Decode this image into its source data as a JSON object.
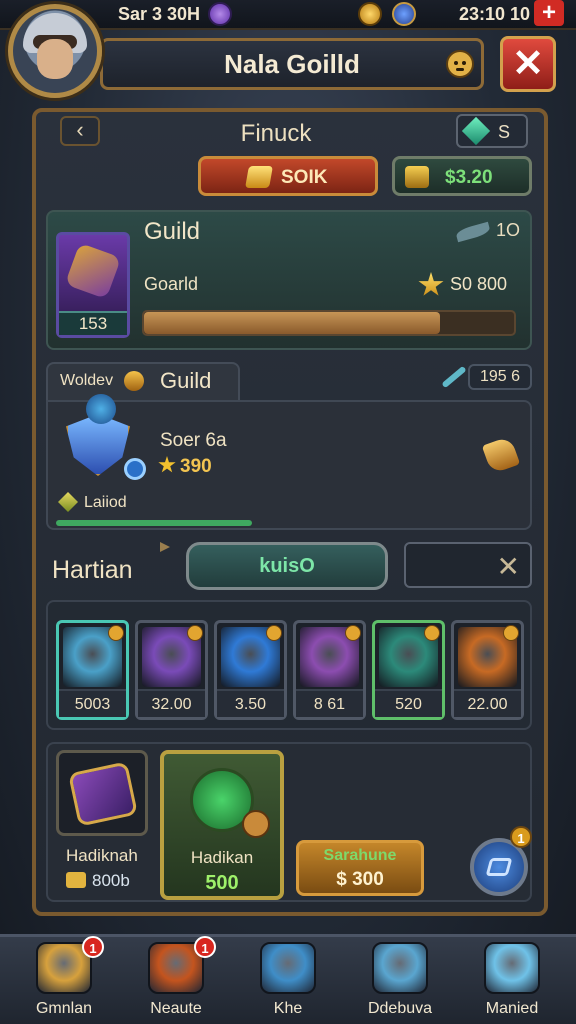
{
  "top": {
    "player_stat": "Sar 3 30H",
    "clock": "23:10 10",
    "plus_label": "+"
  },
  "header": {
    "title": "Nala Goilld"
  },
  "panel": {
    "nav_title": "Finuck",
    "gem_count": "S",
    "gold_button": "SOIK",
    "cash_button": "$3.20",
    "guild_card": {
      "title": "Guild",
      "level": "1O",
      "item_label": "Goarld",
      "item_count": "153",
      "reward": "S0 800",
      "progress": 0.8
    },
    "member_card": {
      "tab_label": "Woldev",
      "tab_title": "Guild",
      "count": "195 6",
      "name": "Soer 6a",
      "stars": "390",
      "label": "Laiiod",
      "progress": 0.42
    },
    "search": {
      "label": "Hartian",
      "value": "kuisO"
    },
    "items": [
      {
        "value": "5003",
        "color": "#4aa0c8",
        "icon": "crystal-axe-icon"
      },
      {
        "value": "32.00",
        "color": "#7a4bb8",
        "icon": "purple-goblin-icon"
      },
      {
        "value": "3.50",
        "color": "#2f7ad6",
        "icon": "blue-orb-icon"
      },
      {
        "value": "8 61",
        "color": "#8c4db0",
        "icon": "pink-imp-icon"
      },
      {
        "value": "520",
        "color": "#2c8a7a",
        "icon": "winged-dragon-icon"
      },
      {
        "value": "22.00",
        "color": "#c76a24",
        "icon": "fire-mask-icon"
      }
    ],
    "bottom_left": {
      "title": "Hadiknah",
      "value": "800b"
    },
    "bottom_mid": {
      "title": "Hadikan",
      "value": "500"
    },
    "bottom_right": {
      "title": "Sarahune",
      "value": "$ 300"
    }
  },
  "nav": [
    {
      "label": "Gmnlan",
      "badge": "1",
      "icon": "quill-banner-icon"
    },
    {
      "label": "Neaute",
      "badge": "1",
      "icon": "gift-chest-icon"
    },
    {
      "label": "Khe",
      "icon": "treasure-box-icon"
    },
    {
      "label": "Ddebuva",
      "icon": "crystal-gem-icon"
    },
    {
      "label": "Manied",
      "icon": "crystal-shard-icon"
    }
  ]
}
